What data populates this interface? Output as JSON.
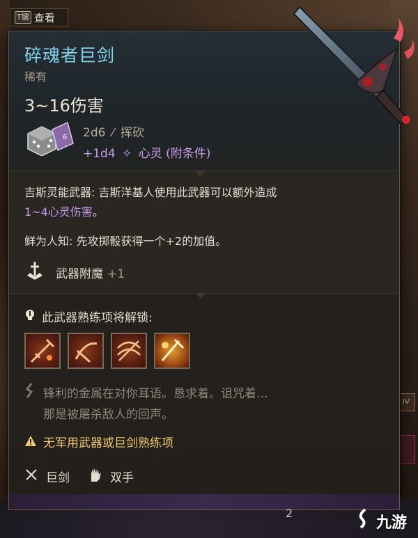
{
  "hint": {
    "key": "T键",
    "label": "查看"
  },
  "item": {
    "name": "碎魂者巨剑",
    "rarity": "稀有",
    "damage_range": "3~16伤害",
    "damage_lines": [
      {
        "dice": "2d6",
        "icon": "slash-icon",
        "type": "挥砍"
      },
      {
        "dice": "+1d4",
        "icon": "psychic-icon",
        "type": "心灵 (附条件)"
      }
    ]
  },
  "description": {
    "psi_weapon": {
      "label": "吉斯灵能武器:",
      "text_line1": " 吉斯洋基人使用此武器可以额外造成",
      "text_line2": "1~4心灵伤害",
      "text_end": "。"
    },
    "lore": "鲜为人知: 先攻掷骰获得一个+2的加值。",
    "enchantment": {
      "label": "武器附魔",
      "value": "+1"
    }
  },
  "proficiency": {
    "title": "此武器熟练项将解锁:",
    "skills": [
      "skill-cleave-icon",
      "skill-rush-icon",
      "skill-lacerate-icon",
      "skill-pommel-icon"
    ]
  },
  "flavor": {
    "line1": "锋利的金属在对你耳语。恳求着。诅咒着…",
    "line2": "那是被屠杀敌人的回声。"
  },
  "warning": "无军用武器或巨剑熟练项",
  "tags": {
    "weapon_type": "巨剑",
    "handedness": "双手"
  },
  "footer": {
    "page_fragment": "2",
    "watermark": "九游"
  },
  "side": {
    "fragment": "IV"
  },
  "colors": {
    "title": "#7fd3ea",
    "psychic": "#c79cec",
    "warning": "#f0c870",
    "panel_border": "#6b5a44"
  }
}
